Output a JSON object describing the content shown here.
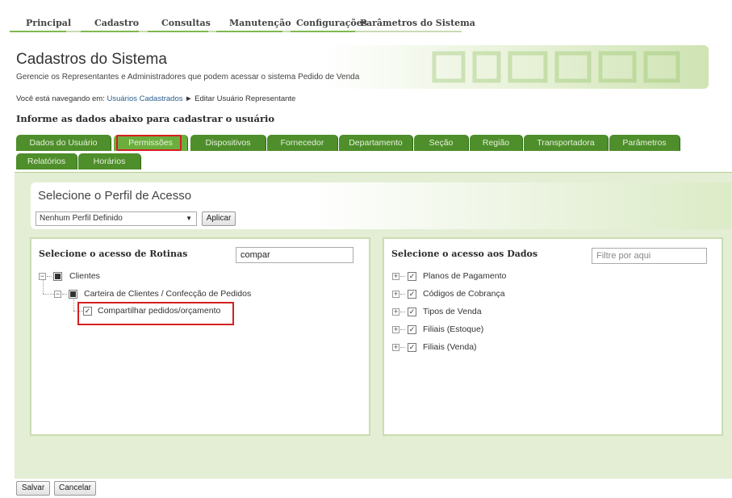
{
  "nav": {
    "items": [
      "Principal",
      "Cadastro",
      "Consultas",
      "Manutenção",
      "Configurações",
      "Parâmetros do Sistema"
    ]
  },
  "header": {
    "title": "Cadastros do Sistema",
    "subtitle": "Gerencie os Representantes e Administradores que podem acessar o sistema Pedido de Venda"
  },
  "breadcrumb": {
    "prefix": "Você está navegando em:",
    "link": "Usuários Cadastrados",
    "separator": "►",
    "current": "Editar Usuário Representante"
  },
  "form_title": "Informe as dados abaixo para cadastrar o usuário",
  "tabs_row1": [
    "Dados do Usuário",
    "Permissões",
    "Dispositivos",
    "Fornecedor",
    "Departamento",
    "Seção",
    "Região",
    "Transportadora",
    "Parâmetros"
  ],
  "tabs_row2": [
    "Relatórios",
    "Horários"
  ],
  "active_tab": "Permissões",
  "profile": {
    "title": "Selecione o Perfil de Acesso",
    "selected": "Nenhum Perfil Definido",
    "apply_label": "Aplicar"
  },
  "routines": {
    "title": "Selecione o acesso de Rotinas",
    "filter_value": "compar",
    "tree": [
      {
        "label": "Clientes",
        "level": 0,
        "expander": "−",
        "state": "partial"
      },
      {
        "label": "Carteira de Clientes / Confecção de Pedidos",
        "level": 1,
        "expander": "−",
        "state": "partial"
      },
      {
        "label": "Compartilhar pedidos/orçamento",
        "level": 2,
        "expander": "",
        "state": "checked"
      }
    ]
  },
  "data_access": {
    "title": "Selecione o acesso aos Dados",
    "filter_placeholder": "Filtre por aqui",
    "items": [
      "Planos de Pagamento",
      "Códigos de Cobrança",
      "Tipos de Venda",
      "Filiais (Estoque)",
      "Filiais (Venda)"
    ]
  },
  "footer": {
    "save_label": "Salvar",
    "cancel_label": "Cancelar"
  },
  "colors": {
    "tab_green": "#4e8e2b",
    "tab_active": "#6cae3e",
    "highlight_red": "#d42020",
    "panel_bg": "#e3eed4"
  }
}
